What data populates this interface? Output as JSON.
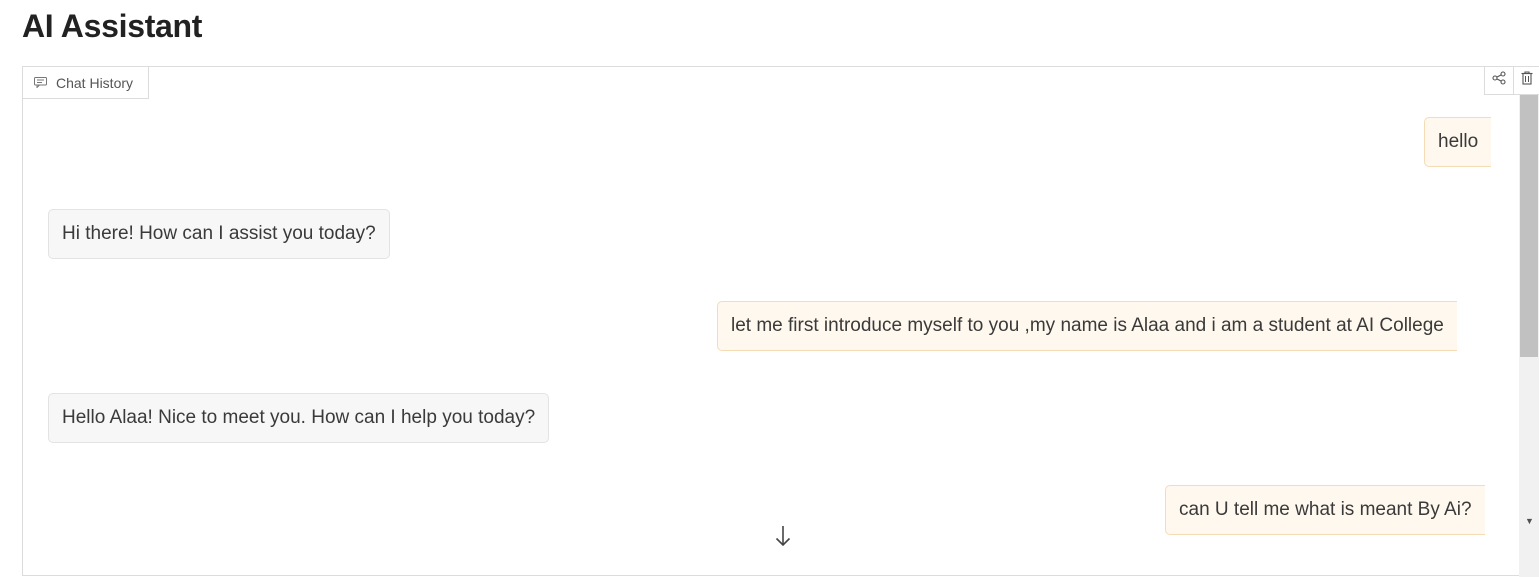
{
  "page": {
    "title": "AI Assistant"
  },
  "toolbar": {
    "chat_history_label": "Chat History",
    "share_icon": "share-icon",
    "delete_icon": "trash-icon"
  },
  "messages": [
    {
      "role": "user",
      "text": "hello"
    },
    {
      "role": "assistant",
      "text": "Hi there! How can I assist you today?"
    },
    {
      "role": "user",
      "text": "let me first introduce myself to you ,my name is Alaa and i am a student at AI College"
    },
    {
      "role": "assistant",
      "text": "Hello Alaa! Nice to meet you. How can I help you today?"
    },
    {
      "role": "user",
      "text": "can U tell me what is meant By Ai?"
    }
  ],
  "colors": {
    "user_bubble_bg": "#fff8ee",
    "user_bubble_border": "#f5dcb4",
    "assistant_bubble_bg": "#f7f7f7",
    "assistant_bubble_border": "#e3e3e3"
  }
}
